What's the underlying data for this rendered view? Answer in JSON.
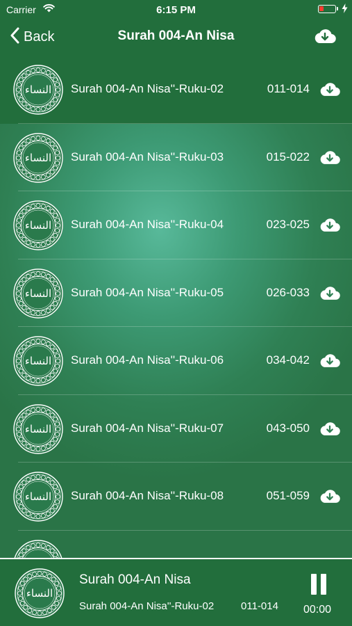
{
  "status_bar": {
    "carrier": "Carrier",
    "time": "6:15 PM",
    "battery_color": "#ff3b30"
  },
  "nav": {
    "back_label": "Back",
    "title": "Surah 004-An Nisa",
    "download_icon": "cloud-download-icon"
  },
  "list": {
    "art_glyph": "النساء",
    "items": [
      {
        "title": "Surah 004-An Nisa''-Ruku-02",
        "range": "011-014"
      },
      {
        "title": "Surah 004-An Nisa''-Ruku-03",
        "range": "015-022"
      },
      {
        "title": "Surah 004-An Nisa''-Ruku-04",
        "range": "023-025"
      },
      {
        "title": "Surah 004-An Nisa''-Ruku-05",
        "range": "026-033"
      },
      {
        "title": "Surah 004-An Nisa''-Ruku-06",
        "range": "034-042"
      },
      {
        "title": "Surah 004-An Nisa''-Ruku-07",
        "range": "043-050"
      },
      {
        "title": "Surah 004-An Nisa''-Ruku-08",
        "range": "051-059"
      },
      {
        "title": "",
        "range": ""
      }
    ]
  },
  "player": {
    "title": "Surah 004-An Nisa",
    "subtitle": "Surah 004-An Nisa''-Ruku-02",
    "range": "011-014",
    "time": "00:00",
    "control": "pause-icon"
  },
  "colors": {
    "bar": "#226e3c",
    "background": "#2f8054",
    "glow": "#58b99a"
  }
}
